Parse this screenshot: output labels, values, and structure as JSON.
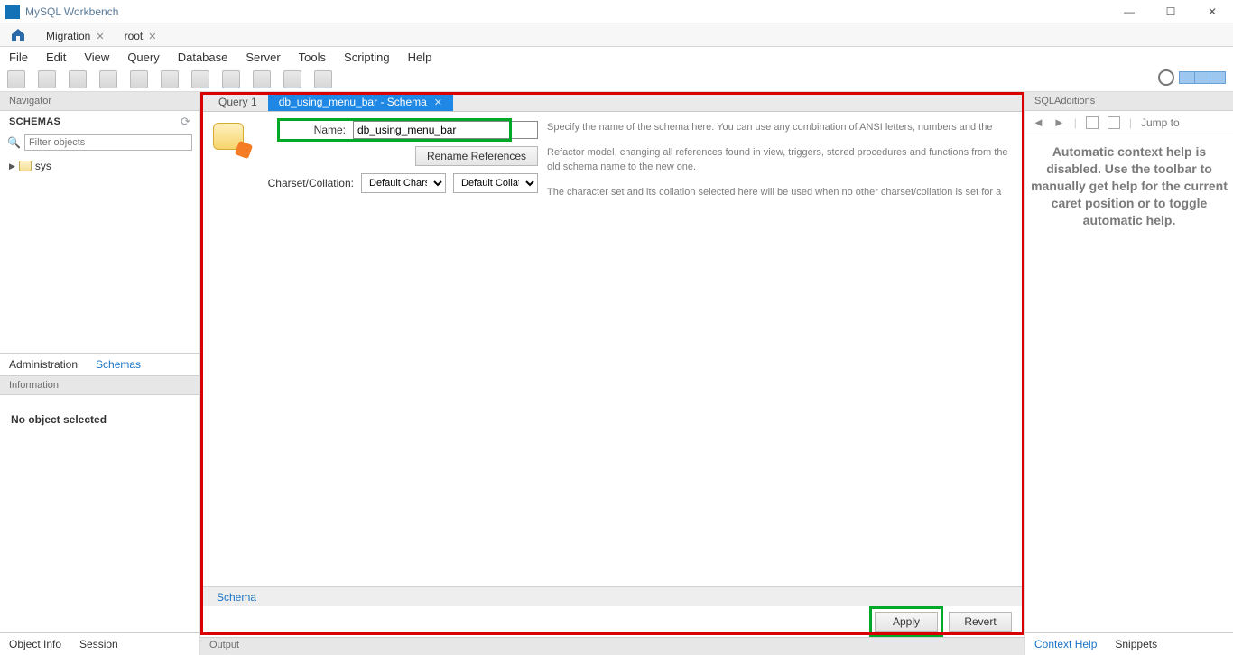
{
  "app": {
    "title": "MySQL Workbench"
  },
  "conn_tabs": [
    {
      "label": "Migration",
      "closable": true
    },
    {
      "label": "root",
      "closable": true
    }
  ],
  "menu": [
    "File",
    "Edit",
    "View",
    "Query",
    "Database",
    "Server",
    "Tools",
    "Scripting",
    "Help"
  ],
  "navigator": {
    "title": "Navigator",
    "schemas_label": "SCHEMAS",
    "filter_placeholder": "Filter objects",
    "tree": [
      {
        "label": "sys"
      }
    ],
    "tabs": {
      "admin": "Administration",
      "schemas": "Schemas"
    },
    "info_title": "Information",
    "info_body": "No object selected",
    "bottom_tabs": {
      "object_info": "Object Info",
      "session": "Session"
    }
  },
  "doc_tabs": [
    {
      "label": "Query 1",
      "active": false
    },
    {
      "label": "db_using_menu_bar - Schema",
      "active": true
    }
  ],
  "schema_form": {
    "name_label": "Name:",
    "name_value": "db_using_menu_bar",
    "rename_btn": "Rename References",
    "charset_label": "Charset/Collation:",
    "charset_value": "Default Charset",
    "collation_value": "Default Collation",
    "desc_name": "Specify the name of the schema here. You can use any combination of ANSI letters, numbers and the",
    "desc_rename": "Refactor model, changing all references found in view, triggers, stored procedures and functions from the old schema name to the new one.",
    "desc_charset": "The character set and its collation selected here will be used when no other charset/collation is set for a"
  },
  "sub_tab": "Schema",
  "buttons": {
    "apply": "Apply",
    "revert": "Revert"
  },
  "output_label": "Output",
  "aside": {
    "title": "SQLAdditions",
    "jump": "Jump to",
    "body": "Automatic context help is disabled. Use the toolbar to manually get help for the current caret position or to toggle automatic help.",
    "tabs": {
      "context": "Context Help",
      "snippets": "Snippets"
    }
  }
}
